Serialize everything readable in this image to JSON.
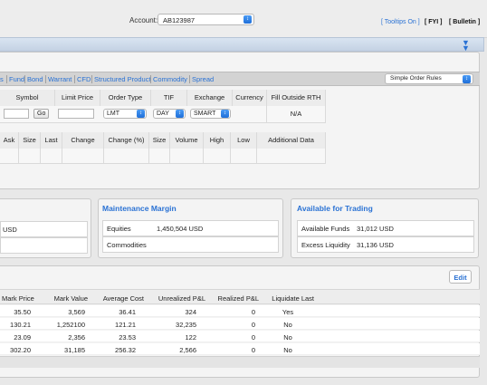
{
  "header": {
    "account_label": "Account:",
    "account_value": "AB123987",
    "tooltips_link": "[ Tooltips On ]",
    "fyi_link": "[ FYI ]",
    "bulletin_link": "[ Bulletin ]"
  },
  "order_entry": {
    "tabs": [
      "s",
      "Fund",
      "Bond",
      "Warrant",
      "CFD",
      "Structured Product",
      "Commodity",
      "Spread"
    ],
    "rules_select": "Simple Order Rules",
    "columns": [
      "Symbol",
      "Limit Price",
      "Order Type",
      "TIF",
      "Exchange",
      "Currency",
      "Fill Outside RTH"
    ],
    "go_label": "Go",
    "order_type": "LMT",
    "tif": "DAY",
    "exchange": "SMART",
    "fill_outside": "N/A",
    "quote_columns": [
      "Ask",
      "Size",
      "Last",
      "Change",
      "Change (%)",
      "Size",
      "Volume",
      "High",
      "Low",
      "Additional Data"
    ]
  },
  "left_box": {
    "value": "USD"
  },
  "maintenance_margin": {
    "title": "Maintenance Margin",
    "rows": [
      {
        "label": "Equities",
        "value": "1,450,504 USD"
      },
      {
        "label": "Commodities",
        "value": ""
      }
    ]
  },
  "available_trading": {
    "title": "Available for Trading",
    "rows": [
      {
        "label": "Available Funds",
        "value": "31,012 USD"
      },
      {
        "label": "Excess Liquidity",
        "value": "31,136 USD"
      }
    ]
  },
  "positions": {
    "edit_label": "Edit",
    "columns": [
      "Mark Price",
      "Mark Value",
      "Average Cost",
      "Unrealized P&L",
      "Realized P&L",
      "Liquidate Last"
    ],
    "rows": [
      [
        "35.50",
        "3,569",
        "36.41",
        "324",
        "0",
        "Yes"
      ],
      [
        "130.21",
        "1,252100",
        "121.21",
        "32,235",
        "0",
        "No"
      ],
      [
        "23.09",
        "2,356",
        "23.53",
        "122",
        "0",
        "No"
      ],
      [
        "302.20",
        "31,185",
        "256.32",
        "2,566",
        "0",
        "No"
      ]
    ]
  }
}
